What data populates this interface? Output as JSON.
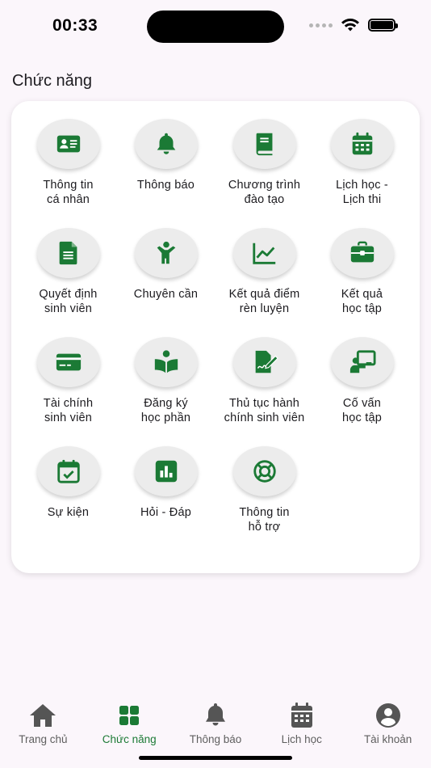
{
  "status_bar": {
    "time": "00:33"
  },
  "section_title": "Chức năng",
  "accent_color": "#1b7a35",
  "features": [
    {
      "label": "Thông tin\ncá nhân",
      "icon": "id-card-icon"
    },
    {
      "label": "Thông báo",
      "icon": "bell-icon"
    },
    {
      "label": "Chương trình\nđào tạo",
      "icon": "book-icon"
    },
    {
      "label": "Lịch học -\nLịch thi",
      "icon": "calendar-icon"
    },
    {
      "label": "Quyết định\nsinh viên",
      "icon": "document-icon"
    },
    {
      "label": "Chuyên cần",
      "icon": "child-icon"
    },
    {
      "label": "Kết quả điểm\nrèn luyện",
      "icon": "line-chart-icon"
    },
    {
      "label": "Kết quả\nhọc tập",
      "icon": "briefcase-icon"
    },
    {
      "label": "Tài chính\nsinh viên",
      "icon": "credit-card-icon"
    },
    {
      "label": "Đăng ký\nhọc phần",
      "icon": "reading-book-icon"
    },
    {
      "label": "Thủ tục hành\nchính sinh viên",
      "icon": "signature-icon"
    },
    {
      "label": "Cố vấn\nhọc tập",
      "icon": "teacher-board-icon"
    },
    {
      "label": "Sự kiện",
      "icon": "calendar-check-icon"
    },
    {
      "label": "Hỏi - Đáp",
      "icon": "bar-chart-icon"
    },
    {
      "label": "Thông tin\nhỗ trợ",
      "icon": "life-ring-icon"
    }
  ],
  "bottom_nav": [
    {
      "label": "Trang chủ",
      "icon": "home-icon",
      "active": false
    },
    {
      "label": "Chức năng",
      "icon": "grid-icon",
      "active": true
    },
    {
      "label": "Thông báo",
      "icon": "bell-icon",
      "active": false
    },
    {
      "label": "Lịch học",
      "icon": "calendar-icon",
      "active": false
    },
    {
      "label": "Tài khoản",
      "icon": "account-icon",
      "active": false
    }
  ]
}
